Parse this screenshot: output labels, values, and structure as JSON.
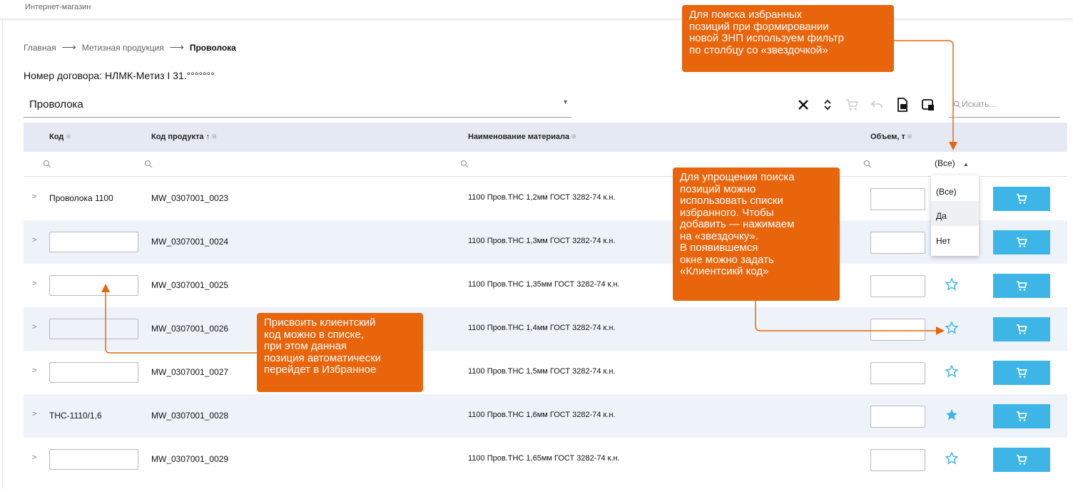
{
  "topbar": {
    "title": "Интернет-магазин"
  },
  "breadcrumb": {
    "home": "Главная",
    "category": "Метизная продукция",
    "current": "Проволока"
  },
  "contract": {
    "label": "Номер договора: НЛМК-Метиз I 31.°°°°°°°"
  },
  "selector": {
    "value": "Проволока"
  },
  "search": {
    "placeholder": "Искать..."
  },
  "table": {
    "headers": {
      "code": "Код",
      "product_code": "Код продукта",
      "name": "Наименование материала",
      "volume": "Объем, т"
    },
    "favorite_filter": {
      "selected": "(Все)",
      "options": [
        "(Все)",
        "Да",
        "Нет"
      ]
    },
    "rows": [
      {
        "code": "Проволока 1100",
        "product_code": "MW_0307001_0023",
        "name": "1100 Пров.ТНС 1,2мм ГОСТ 3282-74 к.н.",
        "favorite": "hidden"
      },
      {
        "code": "",
        "product_code": "MW_0307001_0024",
        "name": "1100 Пров.ТНС 1,3мм ГОСТ 3282-74 к.н.",
        "favorite": "hidden"
      },
      {
        "code": "",
        "product_code": "MW_0307001_0025",
        "name": "1100 Пров.ТНС 1,35мм ГОСТ 3282-74 к.н.",
        "favorite": "outline"
      },
      {
        "code": "",
        "product_code": "MW_0307001_0026",
        "name": "1100 Пров.ТНС 1,4мм ГОСТ 3282-74 к.н.",
        "favorite": "outline"
      },
      {
        "code": "",
        "product_code": "MW_0307001_0027",
        "name": "1100 Пров.ТНС 1,5мм ГОСТ 3282-74 к.н.",
        "favorite": "outline"
      },
      {
        "code": "ТНС-1110/1,6",
        "product_code": "MW_0307001_0028",
        "name": "1100 Пров.ТНС 1,6мм ГОСТ 3282-74 к.н.",
        "favorite": "filled"
      },
      {
        "code": "",
        "product_code": "MW_0307001_0029",
        "name": "1100 Пров.ТНС 1,65мм ГОСТ 3282-74 к.н.",
        "favorite": "outline"
      }
    ]
  },
  "callouts": {
    "filter_hint": [
      "Для поиска избранных",
      "позиций при формировании",
      "новой ЗНП используем фильтр",
      "по столбцу со «звездочкой»"
    ],
    "favorites_hint": [
      "Для упрощения поиска",
      "позиций можно",
      "использовать списки",
      "избранного. Чтобы",
      "добавить — нажимаем",
      "на «звездочку».",
      "В появившемся",
      "окне можно задать",
      "«Клиентсикй код»"
    ],
    "client_code_hint": [
      "Присвоить клиентский",
      "код можно в списке,",
      "при этом данная",
      "позиция автоматически",
      "перейдет в Избранное"
    ]
  },
  "colors": {
    "accent": "#3db5e6",
    "callout": "#e8650c",
    "header_bg": "#e4e9f3",
    "row_alt": "#eef3fa"
  },
  "icons": [
    "close-icon",
    "sort-icon",
    "cart-icon",
    "undo-icon",
    "export-icon",
    "card-icon",
    "search-icon",
    "star-icon",
    "filter-icon",
    "chevron-right-icon"
  ]
}
